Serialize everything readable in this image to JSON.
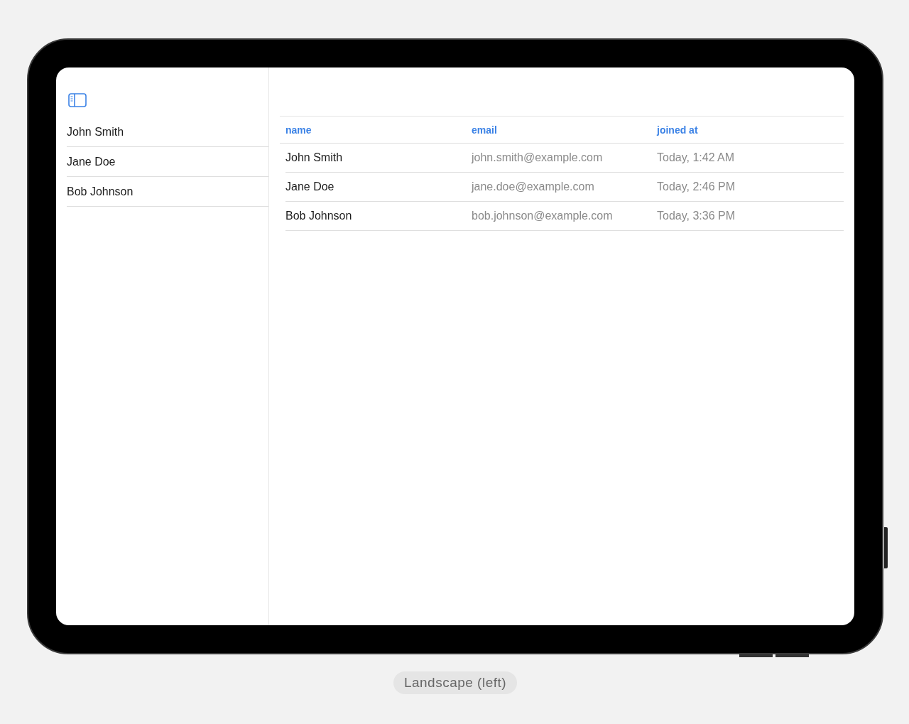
{
  "sidebar": {
    "items": [
      {
        "label": "John Smith"
      },
      {
        "label": "Jane Doe"
      },
      {
        "label": "Bob Johnson"
      }
    ]
  },
  "table": {
    "columns": [
      "name",
      "email",
      "joined at"
    ],
    "rows": [
      [
        "John Smith",
        "john.smith@example.com",
        "Today, 1:42 AM"
      ],
      [
        "Jane Doe",
        "jane.doe@example.com",
        "Today, 2:46 PM"
      ],
      [
        "Bob Johnson",
        "bob.johnson@example.com",
        "Today, 3:36 PM"
      ]
    ]
  },
  "caption": "Landscape (left)"
}
